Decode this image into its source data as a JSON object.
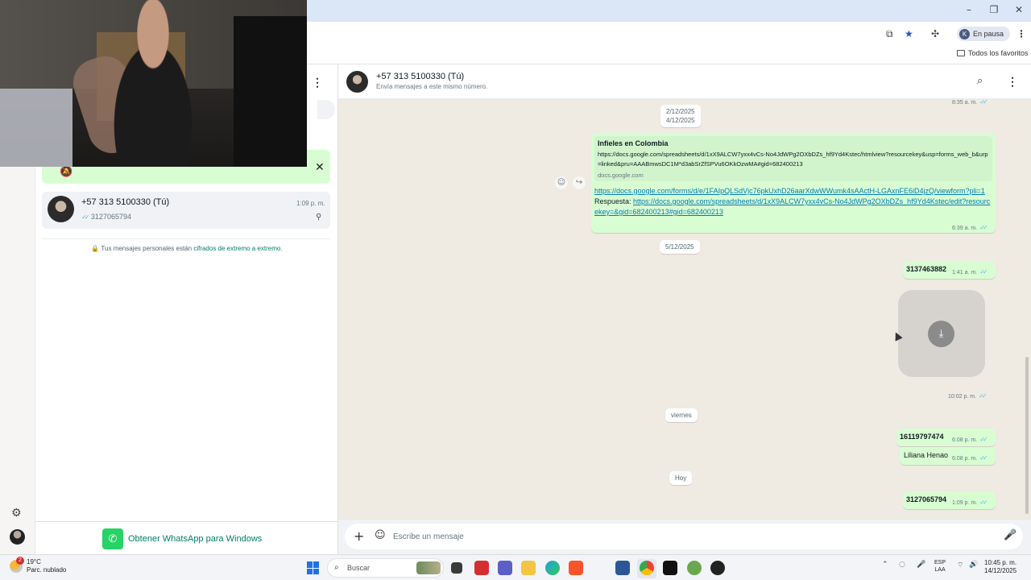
{
  "browser": {
    "profile_initial": "K",
    "profile_status": "En pausa",
    "bookmarks_folder": "Todos los favoritos",
    "window_minimize": "–",
    "window_restore": "❐",
    "window_close": "✕"
  },
  "sidebar": {
    "notice_icon": "bell-off-icon",
    "chats": [
      {
        "name": "+57 313 5100330 (Tú)",
        "time": "1:09 p. m.",
        "preview": "3127065794"
      }
    ],
    "e2e_prefix": "🔒 Tus mensajes personales están ",
    "e2e_link": "cifrados de extremo a extremo",
    "e2e_suffix": ".",
    "get_app_label": "Obtener WhatsApp para Windows"
  },
  "conversation": {
    "title": "+57 313 5100330 (Tú)",
    "subtitle": "Envía mensajes a este mismo número.",
    "top_partial_time": "8:35 a. m.",
    "dates": {
      "d1": "2/12/2025",
      "d2": "4/12/2025",
      "d3": "5/12/2025",
      "d4": "viernes",
      "d5": "Hoy"
    },
    "link_message": {
      "preview_title": "Infieles en Colombia",
      "preview_url": "https://docs.google.com/spreadsheets/d/1xX9ALCW7yxx4vCs-No4JdWPg2OXbDZs_hf9Yd4Kstec/htmlview?resourcekey&usp=forms_web_b&urp=linked&pru=AAABmwsDC1M*d3abSrZfSPVu6OKkOzwMA#gid=682400213",
      "preview_domain": "docs.google.com",
      "form_link": "https://docs.google.com/forms/d/e/1FAIpQLSdVjc76pkUxhD26aarXdwWWumk4sAActH-LGAxnFE6iD4jzQ/viewform?pli=1",
      "answer_label": "Respuesta: ",
      "answer_link": "https://docs.google.com/spreadsheets/d/1xX9ALCW7yxx4vCs-No4JdWPg2OXbDZs_hf9Yd4Kstec/edit?resourcekey=&gid=682400213#gid=682400213",
      "time": "6:39 a. m."
    },
    "messages": [
      {
        "text": "3137463882",
        "time": "1:41 a. m."
      },
      {
        "text": "",
        "time": "10:02 p. m."
      },
      {
        "text": "16119797474",
        "time": "6:08 p. m."
      },
      {
        "text": "Liliana Henao",
        "time": "6:08 p. m."
      },
      {
        "text": "3127065794",
        "time": "1:09 p. m."
      }
    ],
    "composer_placeholder": "Escribe un mensaje"
  },
  "taskbar": {
    "weather_temp": "19°C",
    "weather_desc": "Parc. nublado",
    "weather_badge": "2",
    "search_label": "Buscar",
    "lang_line1": "ESP",
    "lang_line2": "LAA",
    "time": "10:45 p. m.",
    "date": "14/12/2025"
  },
  "colors": {
    "outgoing_bubble": "#d9fdd3",
    "wallpaper": "#efeae2",
    "accent": "#008069",
    "read_tick": "#53bdeb",
    "link": "#027eb5"
  }
}
